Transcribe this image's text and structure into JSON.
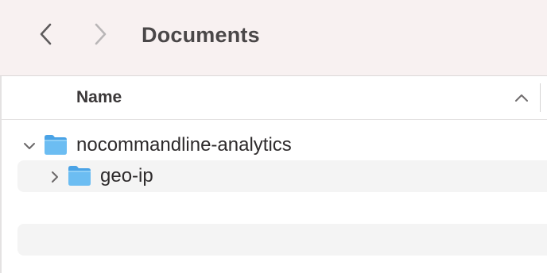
{
  "toolbar": {
    "title": "Documents",
    "back_icon": "chevron-left-icon",
    "forward_icon": "chevron-right-icon"
  },
  "list": {
    "columns": [
      {
        "label": "Name",
        "sort": "ascending",
        "sort_icon": "chevron-up-icon"
      }
    ],
    "rows": [
      {
        "label": "nocommandline-analytics",
        "icon": "folder-icon",
        "expanded": true,
        "level": 0
      },
      {
        "label": "geo-ip",
        "icon": "folder-icon",
        "expanded": false,
        "level": 1
      }
    ]
  },
  "colors": {
    "toolbar_bg": "#f8f1f1",
    "folder_blue": "#5fb3ee",
    "row_stripe": "#f4f4f4"
  }
}
